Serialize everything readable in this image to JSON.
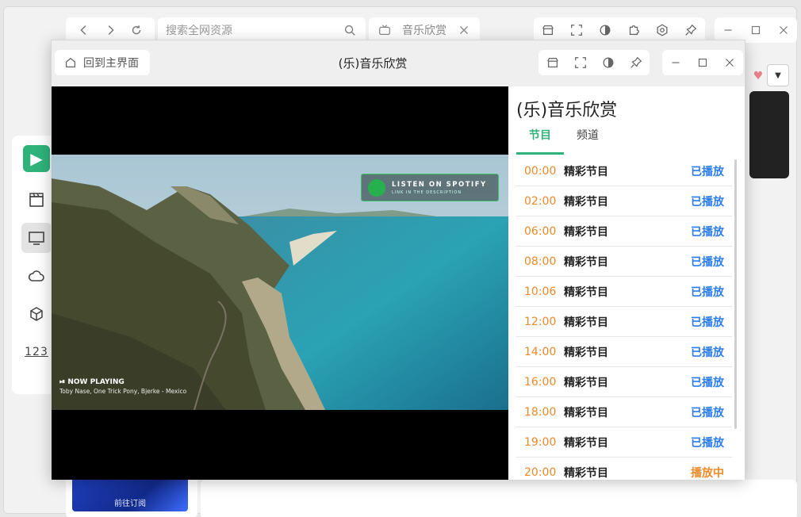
{
  "background": {
    "search": {
      "placeholder": "搜索全网资源"
    },
    "tab": {
      "label": "音乐欣赏"
    },
    "thumb": {
      "caption": "前往订阅"
    }
  },
  "player": {
    "home_label": "回到主界面",
    "title": "(乐)音乐欣赏",
    "video": {
      "spotify_main": "LISTEN ON SPOTIFY",
      "spotify_sub": "LINK IN THE DESCRIPTION",
      "now_playing": "NOW PLAYING",
      "now_playing_sub": "Toby Nase, One Trick Pony, Bjerke - Mexico"
    },
    "epg": {
      "title": "(乐)音乐欣赏",
      "tabs": [
        "节目",
        "频道"
      ],
      "rows": [
        {
          "time": "00:00",
          "name": "精彩节目",
          "status": "已播放"
        },
        {
          "time": "02:00",
          "name": "精彩节目",
          "status": "已播放"
        },
        {
          "time": "06:00",
          "name": "精彩节目",
          "status": "已播放"
        },
        {
          "time": "08:00",
          "name": "精彩节目",
          "status": "已播放"
        },
        {
          "time": "10:06",
          "name": "精彩节目",
          "status": "已播放"
        },
        {
          "time": "12:00",
          "name": "精彩节目",
          "status": "已播放"
        },
        {
          "time": "14:00",
          "name": "精彩节目",
          "status": "已播放"
        },
        {
          "time": "16:00",
          "name": "精彩节目",
          "status": "已播放"
        },
        {
          "time": "18:00",
          "name": "精彩节目",
          "status": "已播放"
        },
        {
          "time": "19:00",
          "name": "精彩节目",
          "status": "已播放"
        },
        {
          "time": "20:00",
          "name": "精彩节目",
          "status": "播放中"
        }
      ]
    }
  },
  "colors": {
    "accent": "#2fb37b",
    "time": "#ee8a2a",
    "played": "#2b7cf0"
  }
}
